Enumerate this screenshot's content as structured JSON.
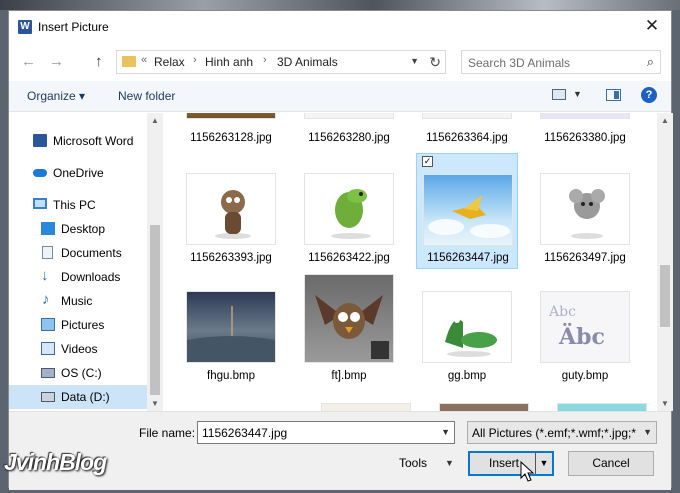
{
  "dialog": {
    "title": "Insert Picture",
    "app_icon": "W",
    "close_glyph": "✕"
  },
  "nav": {
    "back": "←",
    "forward": "→",
    "up": "↑",
    "breadcrumb": [
      "Relax",
      "Hinh anh",
      "3D Animals"
    ],
    "overflow": "«",
    "search_placeholder": "Search 3D Animals"
  },
  "toolbar": {
    "organize": "Organize ▾",
    "new_folder": "New folder",
    "help": "?"
  },
  "sidebar": {
    "items": [
      {
        "label": "Microsoft Word",
        "icon": "word-icon"
      },
      {
        "label": "OneDrive",
        "icon": "cloud-icon"
      },
      {
        "label": "This PC",
        "icon": "computer-icon"
      },
      {
        "label": "Desktop",
        "icon": "desktop-icon"
      },
      {
        "label": "Documents",
        "icon": "documents-icon"
      },
      {
        "label": "Downloads",
        "icon": "downloads-icon"
      },
      {
        "label": "Music",
        "icon": "music-icon"
      },
      {
        "label": "Pictures",
        "icon": "pictures-icon"
      },
      {
        "label": "Videos",
        "icon": "videos-icon"
      },
      {
        "label": "OS (C:)",
        "icon": "drive-icon"
      },
      {
        "label": "Data (D:)",
        "icon": "drive-icon",
        "selected": true
      }
    ]
  },
  "files": [
    {
      "name": "1156263128.jpg"
    },
    {
      "name": "1156263280.jpg"
    },
    {
      "name": "1156263364.jpg"
    },
    {
      "name": "1156263380.jpg"
    },
    {
      "name": "1156263393.jpg"
    },
    {
      "name": "1156263422.jpg"
    },
    {
      "name": "1156263447.jpg",
      "selected": true,
      "checked": "✓"
    },
    {
      "name": "1156263497.jpg"
    },
    {
      "name": "fhgu.bmp"
    },
    {
      "name": "ft].bmp"
    },
    {
      "name": "gg.bmp"
    },
    {
      "name": "guty.bmp"
    }
  ],
  "bottom": {
    "file_name_label": "File name:",
    "file_name_value": "1156263447.jpg",
    "filter": "All Pictures (*.emf;*.wmf;*.jpg;*",
    "tools": "Tools",
    "insert": "Insert",
    "cancel": "Cancel"
  },
  "watermark": "JvinhBlog",
  "colors": {
    "accent": "#0078d7",
    "selection": "#cce8ff",
    "sidebar_selection": "#cce4f7"
  }
}
